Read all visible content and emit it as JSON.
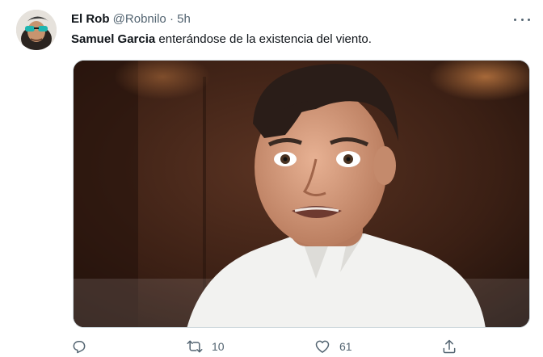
{
  "tweet": {
    "display_name": "El Rob",
    "handle": "@Robnilo",
    "separator": "·",
    "time": "5h",
    "text_bold": "Samuel Garcia",
    "text_rest": " enterándose de la existencia del viento.",
    "actions": {
      "reply_count": "",
      "retweet_count": "10",
      "like_count": "61"
    }
  },
  "icons": {
    "more": "more-dots-icon",
    "reply": "reply-icon",
    "retweet": "retweet-icon",
    "like": "heart-icon",
    "share": "share-icon"
  },
  "colors": {
    "text_primary": "#0f1419",
    "text_secondary": "#536471"
  }
}
